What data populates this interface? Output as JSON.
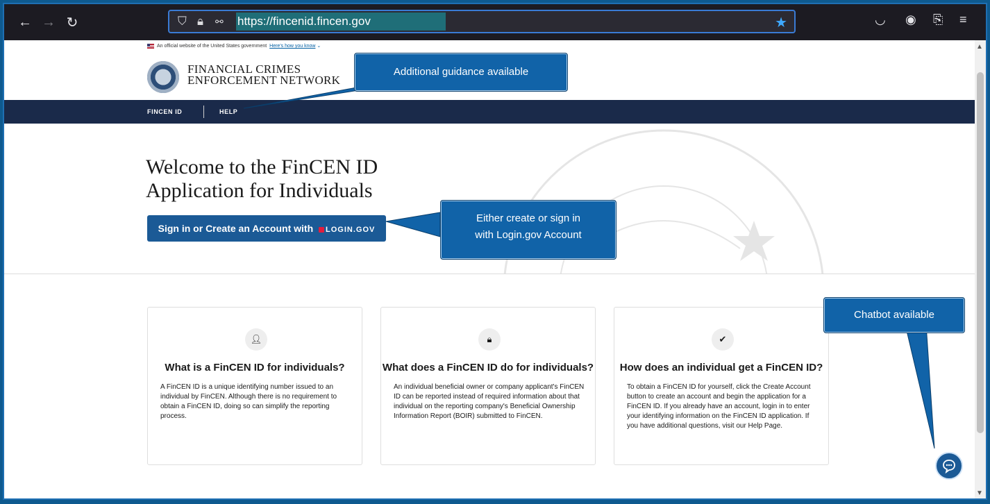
{
  "browser": {
    "url": "https://fincenid.fincen.gov",
    "icons": [
      "back-icon",
      "forward-icon",
      "reload-icon",
      "shield-icon",
      "lock-icon",
      "permissions-icon",
      "bookmark-star-icon",
      "pocket-icon",
      "account-icon",
      "extensions-icon",
      "menu-icon"
    ]
  },
  "gov_banner": {
    "text": "An official website of the United States government",
    "link": "Here's how you know"
  },
  "header": {
    "org_line1": "FINANCIAL CRIMES",
    "org_line2": "ENFORCEMENT NETWORK"
  },
  "nav": {
    "items": [
      "FINCEN ID",
      "HELP"
    ]
  },
  "hero": {
    "title_line1": "Welcome to the FinCEN ID",
    "title_line2": "Application for Individuals",
    "signin_label": "Sign in or Create an Account with",
    "login_gov": "LOGIN.GOV"
  },
  "cards": [
    {
      "icon": "user-icon",
      "title": "What is a FinCEN ID for individuals?",
      "body": "A FinCEN ID is a unique identifying number issued to an individual by FinCEN. Although there is no requirement to obtain a FinCEN ID, doing so can simplify the reporting process."
    },
    {
      "icon": "lock-icon",
      "title": "What does a FinCEN ID do for individuals?",
      "body": "An individual beneficial owner or company applicant's FinCEN ID can be reported instead of required information about that individual on the reporting company's Beneficial Ownership Information Report (BOIR) submitted to FinCEN."
    },
    {
      "icon": "check-badge-icon",
      "title": "How does an individual get a FinCEN ID?",
      "body": "To obtain a FinCEN ID for yourself, click the Create Account button to create an account and begin the application for a FinCEN ID. If you already have an account, login in to enter your identifying information on the FinCEN ID application. If you have additional questions, visit our Help Page."
    }
  ],
  "callouts": {
    "guidance": "Additional guidance available",
    "login_line1": "Either create or sign in",
    "login_line2": "with Login.gov Account",
    "chatbot": "Chatbot available"
  },
  "colors": {
    "navbar": "#1a2a4a",
    "primary_button": "#1b5a96",
    "callout": "#1163a8",
    "browser_chrome": "#1c1b22"
  }
}
